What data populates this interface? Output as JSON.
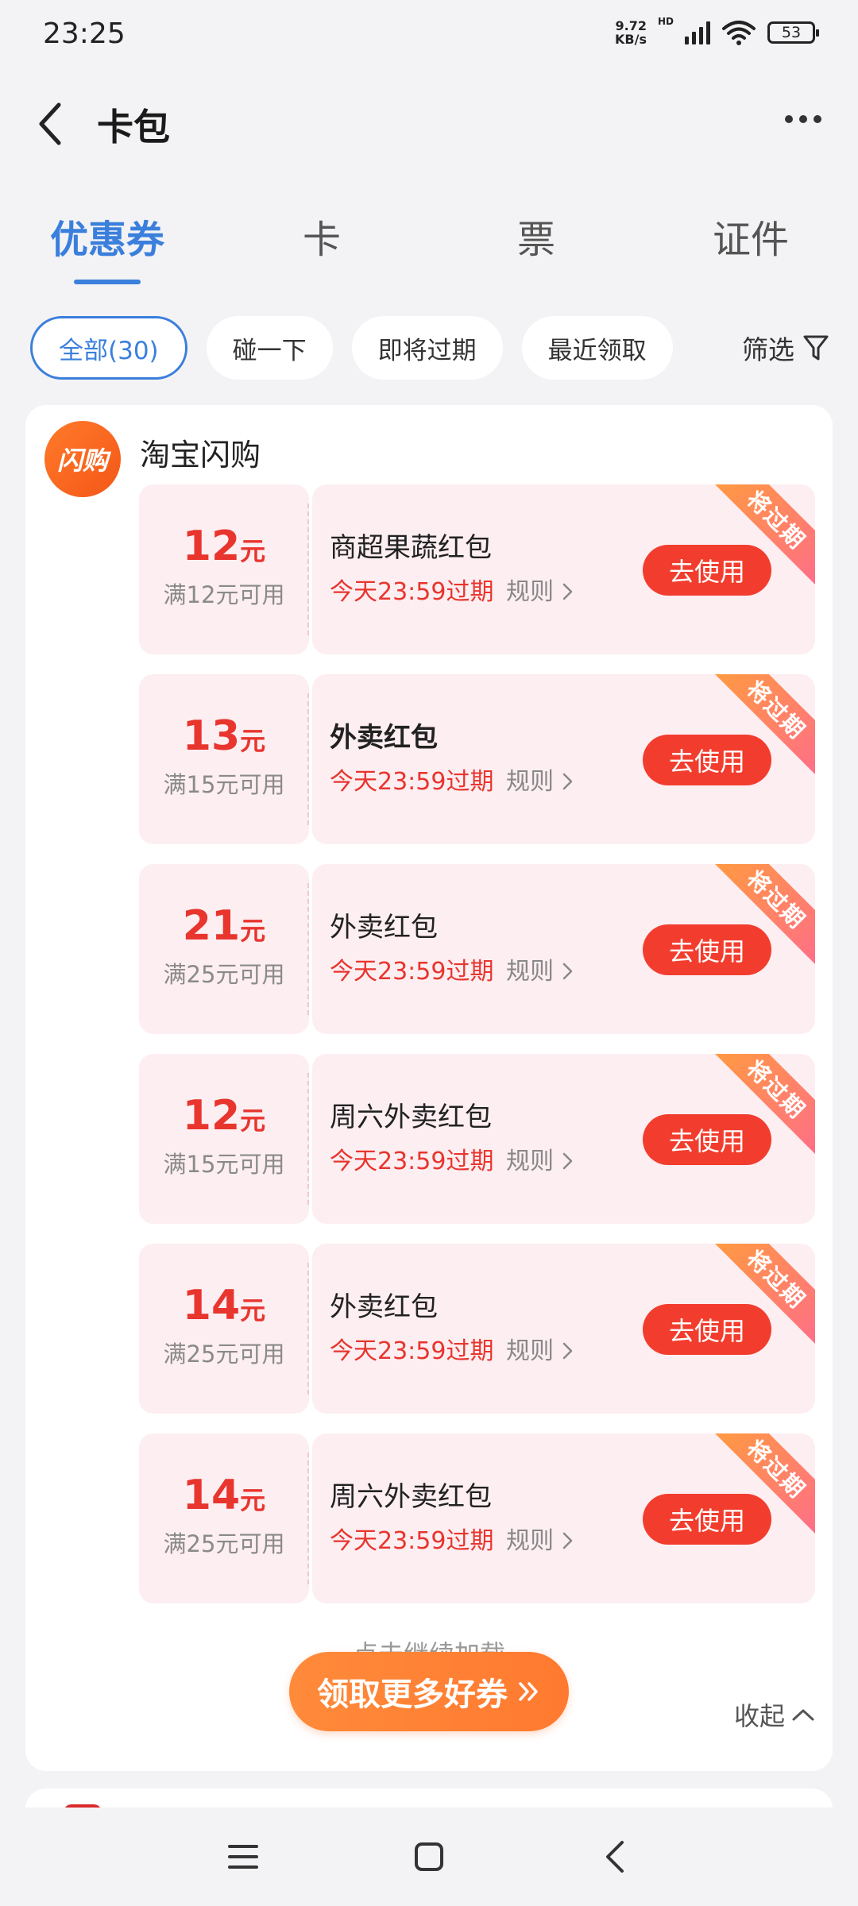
{
  "status_bar": {
    "time": "23:25",
    "net_speed_value": "9.72",
    "net_speed_unit": "KB/s",
    "hd_label": "HD",
    "battery": "53"
  },
  "header": {
    "title": "卡包"
  },
  "tabs": [
    {
      "label": "优惠券",
      "active": true
    },
    {
      "label": "卡",
      "active": false
    },
    {
      "label": "票",
      "active": false
    },
    {
      "label": "证件",
      "active": false
    }
  ],
  "filters": {
    "chips": [
      "全部(30)",
      "碰一下",
      "即将过期",
      "最近领取"
    ],
    "filter_label": "筛选"
  },
  "merchant": {
    "logo_text": "闪购",
    "name": "淘宝闪购"
  },
  "coupons": [
    {
      "amount": "12",
      "unit": "元",
      "condition": "满12元可用",
      "name": "商超果蔬红包",
      "expiry": "今天23:59过期",
      "rule": "规则",
      "button": "去使用",
      "ribbon": "将过期"
    },
    {
      "amount": "13",
      "unit": "元",
      "condition": "满15元可用",
      "name": "外卖红包",
      "expiry": "今天23:59过期",
      "rule": "规则",
      "button": "去使用",
      "ribbon": "将过期"
    },
    {
      "amount": "21",
      "unit": "元",
      "condition": "满25元可用",
      "name": "外卖红包",
      "expiry": "今天23:59过期",
      "rule": "规则",
      "button": "去使用",
      "ribbon": "将过期"
    },
    {
      "amount": "12",
      "unit": "元",
      "condition": "满15元可用",
      "name": "周六外卖红包",
      "expiry": "今天23:59过期",
      "rule": "规则",
      "button": "去使用",
      "ribbon": "将过期"
    },
    {
      "amount": "14",
      "unit": "元",
      "condition": "满25元可用",
      "name": "外卖红包",
      "expiry": "今天23:59过期",
      "rule": "规则",
      "button": "去使用",
      "ribbon": "将过期"
    },
    {
      "amount": "14",
      "unit": "元",
      "condition": "满25元可用",
      "name": "周六外卖红包",
      "expiry": "今天23:59过期",
      "rule": "规则",
      "button": "去使用",
      "ribbon": "将过期"
    }
  ],
  "footer": {
    "load_more": "点击继续加载",
    "get_more": "领取更多好券",
    "collapse": "收起"
  },
  "colors": {
    "accent": "#3b7fdc",
    "coupon_red": "#e8352e",
    "coupon_bg": "#fdeef1",
    "cta_orange": "#ff8a3a"
  }
}
